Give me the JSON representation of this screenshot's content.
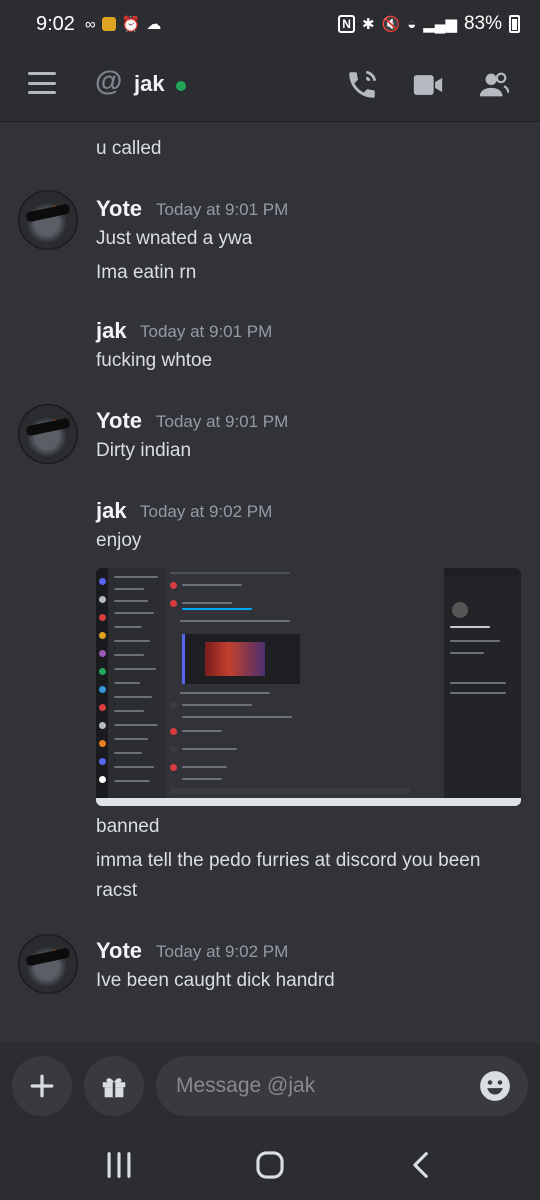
{
  "status_bar": {
    "time": "9:02",
    "battery": "83%"
  },
  "header": {
    "recipient": "jak",
    "status_color": "#23a55a",
    "icons": [
      "call-icon",
      "video-icon",
      "members-icon"
    ]
  },
  "messages": [
    {
      "author": "",
      "timestamp": "",
      "lines": [
        "u called"
      ]
    },
    {
      "author": "Yote",
      "timestamp": "Today at 9:01 PM",
      "lines": [
        "Just wnated a ywa",
        "Ima eatin rn"
      ]
    },
    {
      "author": "jak",
      "timestamp": "Today at 9:01 PM",
      "lines": [
        "fucking whtoe"
      ]
    },
    {
      "author": "Yote",
      "timestamp": "Today at 9:01 PM",
      "lines": [
        "Dirty indian"
      ]
    },
    {
      "author": "jak",
      "timestamp": "Today at 9:02 PM",
      "lines": [
        "enjoy",
        "banned",
        "imma tell the pedo furries at discord you been racst"
      ]
    },
    {
      "author": "Yote",
      "timestamp": "Today at 9:02 PM",
      "lines": [
        "Ive been caught dick handrd"
      ]
    }
  ],
  "input": {
    "placeholder": "Message @jak"
  },
  "colors": {
    "background": "#313338",
    "header": "#2b2d31",
    "online": "#23a55a"
  }
}
